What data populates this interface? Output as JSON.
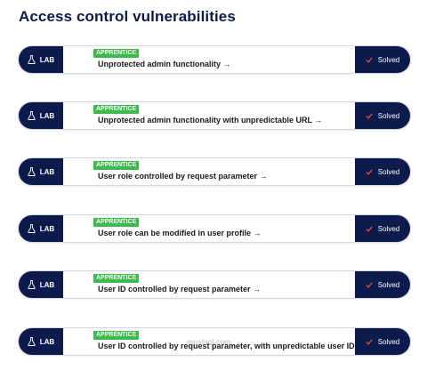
{
  "page": {
    "title": "Access control vulnerabilities"
  },
  "labs": [
    {
      "badge": "LAB",
      "level": "APPRENTICE",
      "title": "Unprotected admin functionality →",
      "status": "Solved"
    },
    {
      "badge": "LAB",
      "level": "APPRENTICE",
      "title": "Unprotected admin functionality with unpredictable URL →",
      "status": "Solved"
    },
    {
      "badge": "LAB",
      "level": "APPRENTICE",
      "title": "User role controlled by request parameter →",
      "status": "Solved"
    },
    {
      "badge": "LAB",
      "level": "APPRENTICE",
      "title": "User role can be modified in user profile →",
      "status": "Solved"
    },
    {
      "badge": "LAB",
      "level": "APPRENTICE",
      "title": "User ID controlled by request parameter →",
      "status": "Solved"
    },
    {
      "badge": "LAB",
      "level": "APPRENTICE",
      "title": "User ID controlled by request parameter, with unpredictable user IDs →",
      "status": "Solved"
    }
  ],
  "watermark": "mostaql.com",
  "colors": {
    "navy": "#0c1a4c",
    "apprentice_green": "#3cbb4b"
  },
  "icons": {
    "lab": "flask-icon",
    "status": "checkmark-icon"
  }
}
